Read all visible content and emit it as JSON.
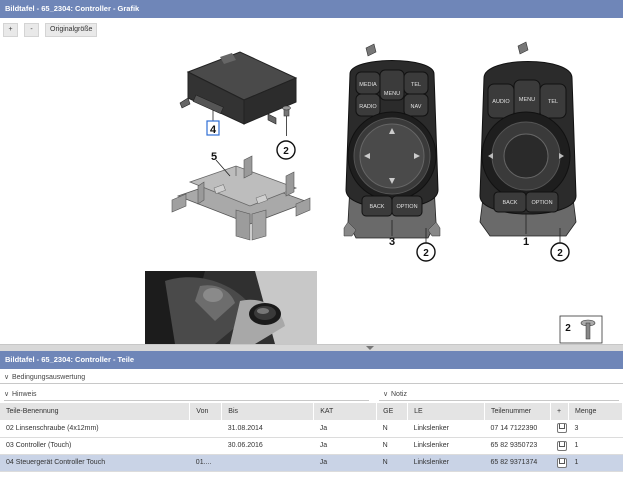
{
  "graphic_panel": {
    "title": "Bildtafel - 65_2304: Controller - Grafik",
    "toolbar": {
      "zoom_in": "+",
      "zoom_out": "-",
      "original_size": "Originalgröße"
    }
  },
  "callouts": {
    "item_4": "4",
    "item_5": "5",
    "item_2a": "2",
    "item_3": "3",
    "item_2b": "2",
    "item_1": "1",
    "item_2c": "2",
    "item_2_legend": "2"
  },
  "controller_labels": {
    "media": "MEDIA",
    "tel": "TEL",
    "menu": "MENU",
    "radio": "RADIO",
    "nav": "NAV",
    "back": "BACK",
    "option": "OPTION",
    "audio": "AUDIO",
    "menu2": "MENU",
    "tel2": "TEL",
    "back2": "BACK",
    "option2": "OPTION"
  },
  "parts_panel": {
    "title": "Bildtafel - 65_2304: Controller - Teile",
    "conditions_label": "Bedingungsauswertung",
    "hint_label": "Hinweis",
    "note_label": "Notiz",
    "columns": [
      "Teile-Benennung",
      "Von",
      "Bis",
      "KAT",
      "GE",
      "LE",
      "Teilenummer",
      "+",
      "Menge"
    ],
    "rows": [
      {
        "name": "02 Linsenschraube (4x12mm)",
        "von": "",
        "bis": "31.08.2014",
        "kat": "Ja",
        "ge": "N",
        "le": "Linkslenker",
        "part_no": "07 14 7122390",
        "qty": "3",
        "selected": false
      },
      {
        "name": "03 Controller (Touch)",
        "von": "",
        "bis": "30.06.2016",
        "kat": "Ja",
        "ge": "N",
        "le": "Linkslenker",
        "part_no": "65 82 9350723",
        "qty": "1",
        "selected": false
      },
      {
        "name": "04 Steuergerät Controller Touch",
        "von": "01....",
        "bis": "",
        "kat": "Ja",
        "ge": "N",
        "le": "Linkslenker",
        "part_no": "65 82 9371374",
        "qty": "1",
        "selected": true
      }
    ]
  },
  "colors": {
    "header_bg": "#6f86b8",
    "selected_row": "#c9d3e6"
  }
}
